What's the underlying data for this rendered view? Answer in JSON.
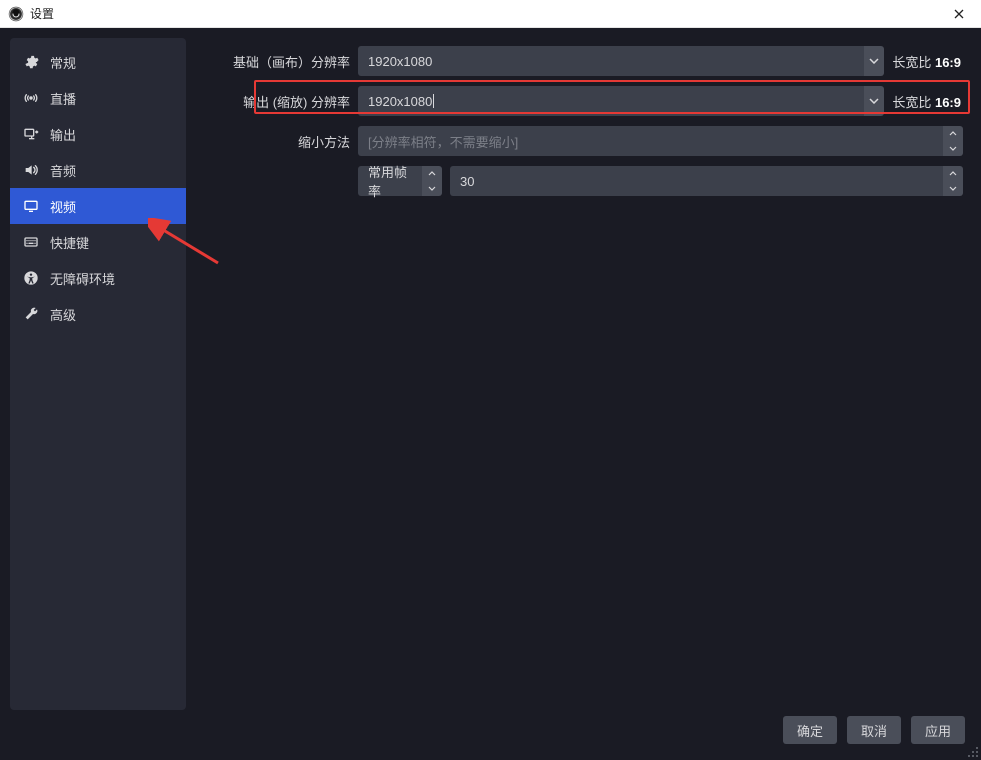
{
  "window": {
    "title": "设置"
  },
  "sidebar": {
    "items": [
      {
        "label": "常规"
      },
      {
        "label": "直播"
      },
      {
        "label": "输出"
      },
      {
        "label": "音频"
      },
      {
        "label": "视频"
      },
      {
        "label": "快捷键"
      },
      {
        "label": "无障碍环境"
      },
      {
        "label": "高级"
      }
    ],
    "active_index": 4
  },
  "form": {
    "base_resolution": {
      "label": "基础（画布）分辨率",
      "value": "1920x1080",
      "aspect_prefix": "长宽比",
      "aspect_value": "16:9"
    },
    "output_resolution": {
      "label": "输出 (缩放) 分辨率",
      "value": "1920x1080",
      "aspect_prefix": "长宽比",
      "aspect_value": "16:9"
    },
    "downscale_filter": {
      "label": "缩小方法",
      "placeholder": "[分辨率相符，不需要缩小]"
    },
    "fps": {
      "type_label": "常用帧率",
      "value": "30"
    }
  },
  "footer": {
    "ok": "确定",
    "cancel": "取消",
    "apply": "应用"
  }
}
